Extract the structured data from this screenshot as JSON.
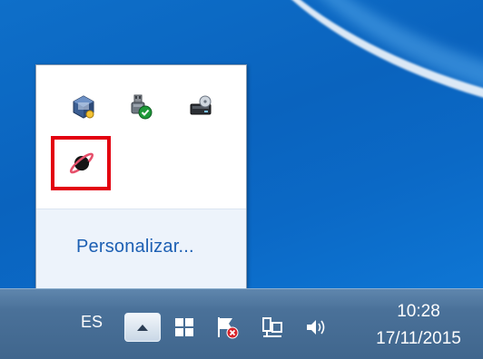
{
  "tray_overflow": {
    "icons": [
      {
        "name": "virtualbox-icon",
        "label": ""
      },
      {
        "name": "safely-remove-hardware-icon",
        "label": ""
      },
      {
        "name": "disk-drive-icon",
        "label": ""
      },
      {
        "name": "planet-app-icon",
        "label": ""
      }
    ],
    "highlight_color": "#e3000f",
    "customize_label": "Personalizar..."
  },
  "taskbar": {
    "language": "ES",
    "time": "10:28",
    "date": "17/11/2015"
  },
  "colors": {
    "desktop": "#0b69c6",
    "taskbar": "#4a7199",
    "link": "#1c5fb3"
  }
}
